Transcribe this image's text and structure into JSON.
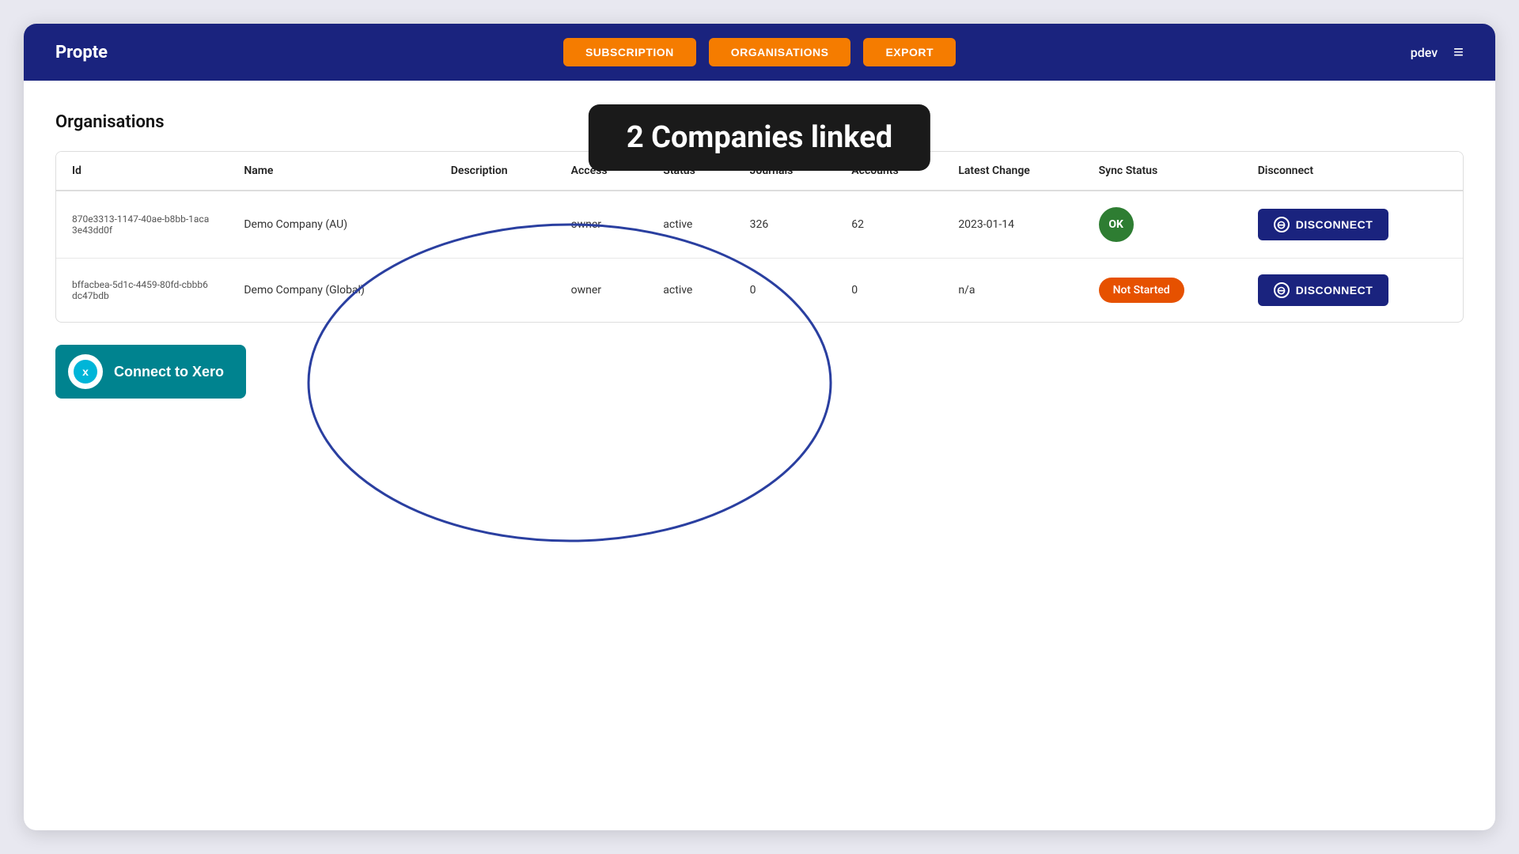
{
  "header": {
    "logo": "Propte",
    "nav": [
      {
        "label": "SUBSCRIPTION",
        "key": "subscription"
      },
      {
        "label": "ORGANISATIONS",
        "key": "organisations"
      },
      {
        "label": "EXPORT",
        "key": "export"
      }
    ],
    "username": "pdev",
    "menu_icon": "≡"
  },
  "tooltip": {
    "text": "2 Companies linked"
  },
  "page": {
    "title": "Organisations"
  },
  "table": {
    "columns": [
      {
        "label": "Id",
        "key": "id"
      },
      {
        "label": "Name",
        "key": "name"
      },
      {
        "label": "Description",
        "key": "description"
      },
      {
        "label": "Access",
        "key": "access"
      },
      {
        "label": "Status",
        "key": "status"
      },
      {
        "label": "Journals",
        "key": "journals"
      },
      {
        "label": "Accounts",
        "key": "accounts"
      },
      {
        "label": "Latest Change",
        "key": "latest_change"
      },
      {
        "label": "Sync Status",
        "key": "sync_status"
      },
      {
        "label": "Disconnect",
        "key": "disconnect"
      }
    ],
    "rows": [
      {
        "id": "870e3313-1147-40ae-b8bb-1aca3e43dd0f",
        "name": "Demo Company (AU)",
        "description": "",
        "access": "owner",
        "status": "active",
        "journals": "326",
        "accounts": "62",
        "latest_change": "2023-01-14",
        "sync_status_type": "ok",
        "sync_status_label": "OK",
        "disconnect_label": "DISCONNECT"
      },
      {
        "id": "bffacbea-5d1c-4459-80fd-cbbb6dc47bdb",
        "name": "Demo Company (Global)",
        "description": "",
        "access": "owner",
        "status": "active",
        "journals": "0",
        "accounts": "0",
        "latest_change": "n/a",
        "sync_status_type": "not_started",
        "sync_status_label": "Not Started",
        "disconnect_label": "DISCONNECT"
      }
    ]
  },
  "connect_button": {
    "label": "Connect to Xero"
  },
  "colors": {
    "header_bg": "#1a237e",
    "nav_btn_bg": "#f57c00",
    "ok_badge": "#2e7d32",
    "not_started_badge": "#e65100",
    "disconnect_btn": "#1a237e",
    "connect_btn": "#00838f"
  }
}
